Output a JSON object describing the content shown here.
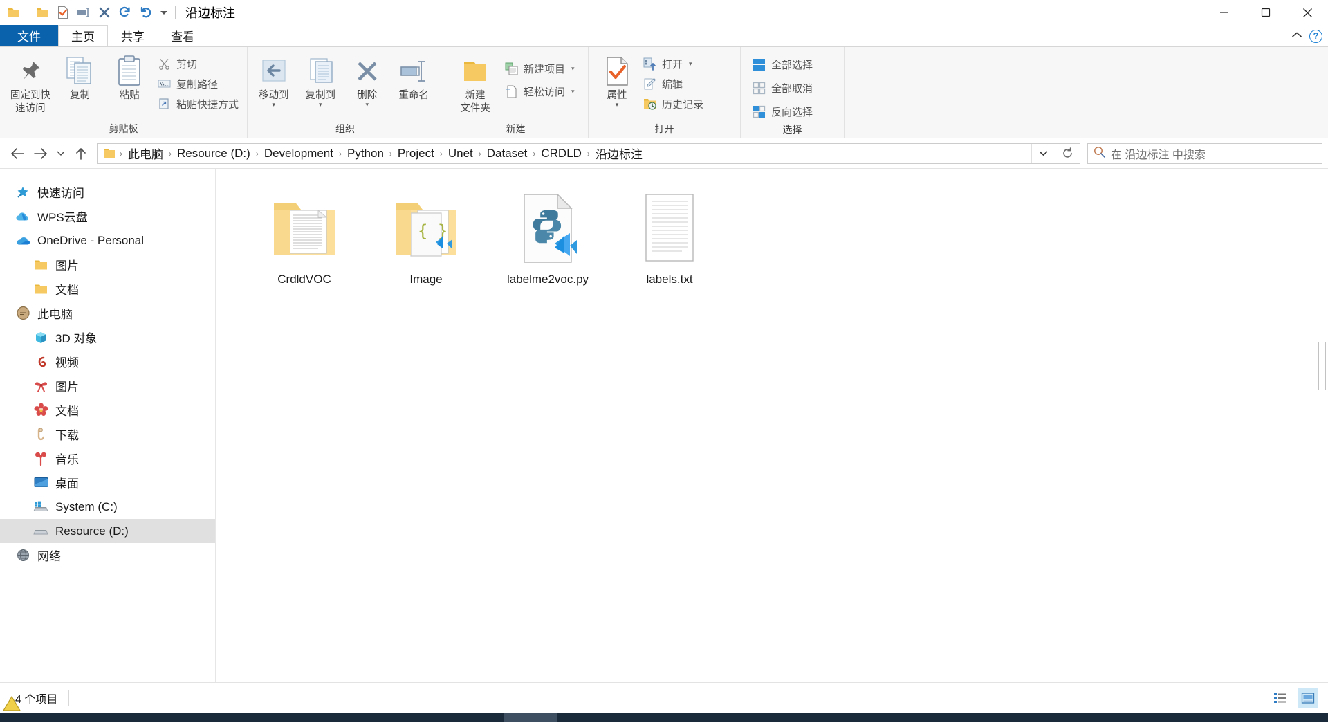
{
  "window": {
    "title": "沿边标注",
    "quick_access": [
      {
        "name": "folder-icon",
        "label": "文件夹"
      },
      {
        "name": "properties-icon",
        "label": "属性"
      },
      {
        "name": "new-folder-icon",
        "label": "新建文件夹"
      },
      {
        "name": "rename-icon",
        "label": "重命名"
      },
      {
        "name": "delete-icon",
        "label": "删除"
      },
      {
        "name": "redo-icon",
        "label": "恢复"
      },
      {
        "name": "undo-icon",
        "label": "撤销"
      }
    ],
    "controls": {
      "minimize": "─",
      "maximize": "☐",
      "close": "✕"
    }
  },
  "tabs": [
    {
      "id": "file",
      "label": "文件"
    },
    {
      "id": "home",
      "label": "主页"
    },
    {
      "id": "share",
      "label": "共享"
    },
    {
      "id": "view",
      "label": "查看"
    }
  ],
  "tabstrip_right": {
    "collapse_caret": "∧",
    "help": "?"
  },
  "ribbon": {
    "groups": [
      {
        "id": "clipboard",
        "label": "剪贴板",
        "big_buttons": [
          {
            "name": "pin-to-quick-access-button",
            "label": "固定到快\n速访问",
            "line1": "固定到快",
            "line2": "速访问",
            "icon": "pin-icon"
          },
          {
            "name": "copy-button",
            "label": "复制",
            "icon": "copy-icon"
          },
          {
            "name": "paste-button",
            "label": "粘贴",
            "icon": "paste-icon"
          }
        ],
        "small_buttons": [
          {
            "name": "cut-button",
            "label": "剪切",
            "icon": "scissors-icon"
          },
          {
            "name": "copy-path-button",
            "label": "复制路径",
            "icon": "copy-path-icon"
          },
          {
            "name": "paste-shortcut-button",
            "label": "粘贴快捷方式",
            "icon": "paste-shortcut-icon"
          }
        ]
      },
      {
        "id": "organize",
        "label": "组织",
        "big_buttons": [
          {
            "name": "move-to-button",
            "label": "移动到",
            "icon": "move-to-icon",
            "caret": "▾"
          },
          {
            "name": "copy-to-button",
            "label": "复制到",
            "icon": "copy-to-icon",
            "caret": "▾"
          },
          {
            "name": "delete-button",
            "label": "删除",
            "icon": "delete-x-icon",
            "caret": "▾"
          },
          {
            "name": "rename-button",
            "label": "重命名",
            "icon": "rename-icon"
          }
        ],
        "small_buttons": []
      },
      {
        "id": "new",
        "label": "新建",
        "big_buttons": [
          {
            "name": "new-folder-button",
            "label": "新建\n文件夹",
            "line1": "新建",
            "line2": "文件夹",
            "icon": "new-folder-icon"
          }
        ],
        "small_buttons": [
          {
            "name": "new-item-button",
            "label": "新建项目",
            "icon": "new-item-icon",
            "caret": "▾"
          },
          {
            "name": "easy-access-button",
            "label": "轻松访问",
            "icon": "easy-access-icon",
            "caret": "▾"
          }
        ]
      },
      {
        "id": "open",
        "label": "打开",
        "big_buttons": [
          {
            "name": "properties-button",
            "label": "属性",
            "icon": "properties-icon",
            "caret": "▾"
          }
        ],
        "small_buttons": [
          {
            "name": "open-button",
            "label": "打开",
            "icon": "open-icon",
            "caret": "▾"
          },
          {
            "name": "edit-button",
            "label": "编辑",
            "icon": "edit-icon"
          },
          {
            "name": "history-button",
            "label": "历史记录",
            "icon": "history-icon"
          }
        ]
      },
      {
        "id": "select",
        "label": "选择",
        "big_buttons": [],
        "small_buttons": [
          {
            "name": "select-all-button",
            "label": "全部选择",
            "icon": "select-all-icon"
          },
          {
            "name": "select-none-button",
            "label": "全部取消",
            "icon": "select-none-icon"
          },
          {
            "name": "invert-selection-button",
            "label": "反向选择",
            "icon": "invert-selection-icon"
          }
        ]
      }
    ]
  },
  "address_bar": {
    "back": "←",
    "forward": "→",
    "recent_caret": "∨",
    "up": "↑",
    "breadcrumbs": [
      "此电脑",
      "Resource (D:)",
      "Development",
      "Python",
      "Project",
      "Unet",
      "Dataset",
      "CRDLD",
      "沿边标注"
    ],
    "separator": "›",
    "dropdown_caret": "∨",
    "refresh": "↻",
    "search_placeholder": "在 沿边标注 中搜索"
  },
  "sidebar": {
    "items": [
      {
        "label": "快速访问",
        "icon": "star-pin-icon",
        "indent": 0,
        "selected": false
      },
      {
        "label": "WPS云盘",
        "icon": "wps-cloud-icon",
        "indent": 0,
        "selected": false
      },
      {
        "label": "OneDrive - Personal",
        "icon": "onedrive-icon",
        "indent": 0,
        "selected": false
      },
      {
        "label": "图片",
        "icon": "folder-icon",
        "indent": 1,
        "selected": false
      },
      {
        "label": "文档",
        "icon": "folder-icon",
        "indent": 1,
        "selected": false
      },
      {
        "label": "此电脑",
        "icon": "this-pc-icon",
        "indent": 0,
        "selected": false
      },
      {
        "label": "3D 对象",
        "icon": "3d-objects-icon",
        "indent": 1,
        "selected": false
      },
      {
        "label": "视频",
        "icon": "videos-icon",
        "indent": 1,
        "selected": false
      },
      {
        "label": "图片",
        "icon": "pictures-icon",
        "indent": 1,
        "selected": false
      },
      {
        "label": "文档",
        "icon": "documents-icon",
        "indent": 1,
        "selected": false
      },
      {
        "label": "下载",
        "icon": "downloads-icon",
        "indent": 1,
        "selected": false
      },
      {
        "label": "音乐",
        "icon": "music-icon",
        "indent": 1,
        "selected": false
      },
      {
        "label": "桌面",
        "icon": "desktop-icon",
        "indent": 1,
        "selected": false
      },
      {
        "label": "System (C:)",
        "icon": "system-drive-icon",
        "indent": 1,
        "selected": false
      },
      {
        "label": "Resource (D:)",
        "icon": "drive-icon",
        "indent": 1,
        "selected": true
      },
      {
        "label": "网络",
        "icon": "network-icon",
        "indent": 0,
        "selected": false
      }
    ]
  },
  "files": [
    {
      "name": "CrdldVOC",
      "type": "folder-with-doc",
      "icon": "folder-doc-icon"
    },
    {
      "name": "Image",
      "type": "folder-with-json",
      "icon": "folder-json-icon"
    },
    {
      "name": "labelme2voc.py",
      "type": "python-file",
      "icon": "python-vscode-icon"
    },
    {
      "name": "labels.txt",
      "type": "text-file",
      "icon": "text-file-icon"
    }
  ],
  "status_bar": {
    "item_count": "4 个项目",
    "views": [
      {
        "name": "details-view-button",
        "icon": "details-view-icon",
        "active": false
      },
      {
        "name": "large-icons-view-button",
        "icon": "large-icons-view-icon",
        "active": true
      }
    ]
  },
  "colors": {
    "accent": "#0a62ad",
    "selection": "#e0e0e0",
    "ribbon_bg": "#f7f7f7",
    "folder_yellow": "#ffd77a",
    "python_blue": "#36708f",
    "vscode_blue": "#1d8fe0",
    "taskbar": "#1b2a3a"
  }
}
